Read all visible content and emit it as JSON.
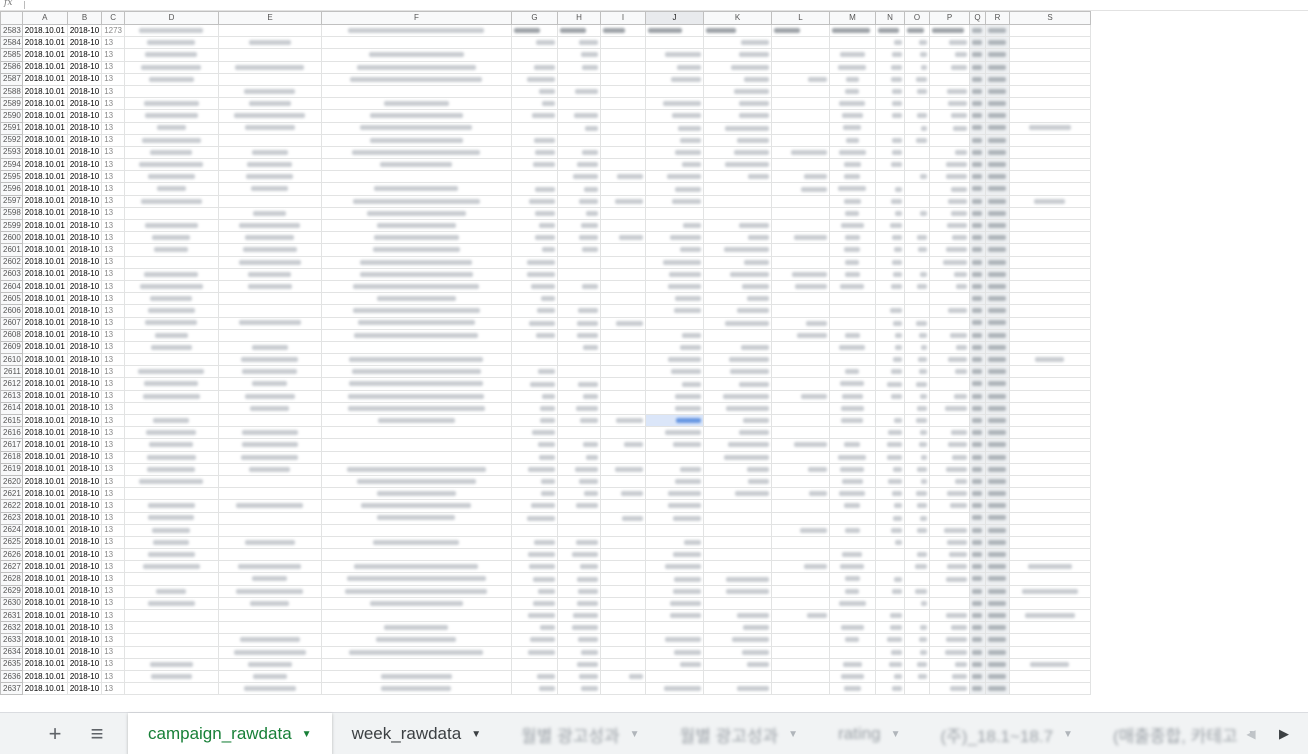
{
  "formula_bar": {
    "fx_symbol": "fx"
  },
  "columns": [
    "A",
    "B",
    "C",
    "D",
    "E",
    "F",
    "G",
    "H",
    "I",
    "J",
    "K",
    "L",
    "M",
    "N",
    "O",
    "P",
    "Q",
    "R",
    "S"
  ],
  "active_column": "J",
  "row_start": 2583,
  "row_count": 55,
  "cell_values": {
    "A": "2018.10.01",
    "B": "2018-10",
    "C_first": "1273",
    "C": "13"
  },
  "first_row_partial": {
    "G": "1730",
    "H": "3322",
    "I": "332",
    "J": "845830",
    "K": "68448",
    "L": "3330",
    "M": "2018.10.31",
    "N": "45.10%",
    "O": "11.28%",
    "P": "8751.58%"
  },
  "highlight_cell": {
    "column": "J",
    "row_index": 32
  },
  "sheet_tabs": [
    {
      "label": "campaign_rawdata",
      "active": true,
      "blurred": false
    },
    {
      "label": "week_rawdata",
      "active": false,
      "blurred": false
    },
    {
      "label": "월별 광고성과",
      "active": false,
      "blurred": true
    },
    {
      "label": "월별 광고성과",
      "active": false,
      "blurred": true
    },
    {
      "label": "rating",
      "active": false,
      "blurred": true
    },
    {
      "label": "(주)_18.1~18.7",
      "active": false,
      "blurred": true
    },
    {
      "label": "(매출종합, 카테고",
      "active": false,
      "blurred": true
    }
  ],
  "tab_caret": "▼",
  "icons": {
    "add_sheet": "plus-icon",
    "all_sheets": "menu-icon",
    "scroll_right": "chevron-right-icon",
    "scroll_left": "chevron-left-icon"
  },
  "colors": {
    "active_tab_text": "#188038",
    "highlight": "#5b8fe0",
    "header_bg": "#f8f9fa"
  }
}
